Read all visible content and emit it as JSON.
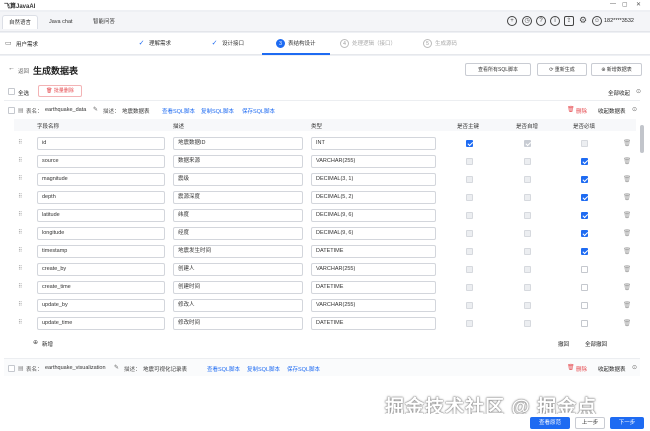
{
  "app": {
    "title": "飞算JavaAI"
  },
  "tabs": [
    {
      "label": "自然语言"
    },
    {
      "label": "Java chat"
    },
    {
      "label": "智能问答"
    }
  ],
  "user": {
    "phone": "182****3532"
  },
  "breadcrumb": {
    "label": "用户需求"
  },
  "steps": [
    {
      "label": "理解需求",
      "state": "done"
    },
    {
      "label": "设计接口",
      "state": "done"
    },
    {
      "num": "3",
      "label": "表结构设计",
      "state": "current"
    },
    {
      "num": "4",
      "label": "处理逻辑（接口）",
      "state": "todo"
    },
    {
      "num": "5",
      "label": "生成源码",
      "state": "todo"
    }
  ],
  "page": {
    "back_label": "返回",
    "title": "生成数据表"
  },
  "toolbar": {
    "view_sql": "查看所有SQL脚本",
    "regenerate": "重新生成",
    "add_table": "新增数据表",
    "select_all": "全选",
    "batch_delete": "批量删除",
    "collapse_all": "全部收起"
  },
  "table1": {
    "name_label": "表名：",
    "name": "earthquake_data",
    "desc_label": "描述：",
    "desc": "地震数据表",
    "view_sql": "查看SQL脚本",
    "copy_sql": "复制SQL脚本",
    "save_sql": "保存SQL脚本",
    "delete": "删除",
    "collapse": "收起数据表"
  },
  "columns": {
    "field": "字段名称",
    "desc": "描述",
    "type": "类型",
    "pk": "是否主键",
    "auto_inc": "是否自增",
    "required": "是否必填"
  },
  "rows": [
    {
      "field": "id",
      "desc": "地震数据ID",
      "type": "INT",
      "pk": true,
      "auto_inc": true,
      "required": false,
      "pk_disabled": false,
      "auto_disabled": true,
      "req_disabled": true
    },
    {
      "field": "source",
      "desc": "数据来源",
      "type": "VARCHAR(255)",
      "pk": false,
      "auto_inc": false,
      "required": true,
      "pk_disabled": true,
      "auto_disabled": true,
      "req_disabled": false
    },
    {
      "field": "magnitude",
      "desc": "震级",
      "type": "DECIMAL(3, 1)",
      "pk": false,
      "auto_inc": false,
      "required": true,
      "pk_disabled": true,
      "auto_disabled": true,
      "req_disabled": false
    },
    {
      "field": "depth",
      "desc": "震源深度",
      "type": "DECIMAL(5, 2)",
      "pk": false,
      "auto_inc": false,
      "required": true,
      "pk_disabled": true,
      "auto_disabled": true,
      "req_disabled": false
    },
    {
      "field": "latitude",
      "desc": "纬度",
      "type": "DECIMAL(9, 6)",
      "pk": false,
      "auto_inc": false,
      "required": true,
      "pk_disabled": true,
      "auto_disabled": true,
      "req_disabled": false
    },
    {
      "field": "longitude",
      "desc": "经度",
      "type": "DECIMAL(9, 6)",
      "pk": false,
      "auto_inc": false,
      "required": true,
      "pk_disabled": true,
      "auto_disabled": true,
      "req_disabled": false
    },
    {
      "field": "timestamp",
      "desc": "地震发生时间",
      "type": "DATETIME",
      "pk": false,
      "auto_inc": false,
      "required": true,
      "pk_disabled": true,
      "auto_disabled": true,
      "req_disabled": false
    },
    {
      "field": "create_by",
      "desc": "创建人",
      "type": "VARCHAR(255)",
      "pk": false,
      "auto_inc": false,
      "required": false,
      "pk_disabled": true,
      "auto_disabled": true,
      "req_disabled": false
    },
    {
      "field": "create_time",
      "desc": "创建时间",
      "type": "DATETIME",
      "pk": false,
      "auto_inc": false,
      "required": false,
      "pk_disabled": true,
      "auto_disabled": true,
      "req_disabled": false
    },
    {
      "field": "update_by",
      "desc": "修改人",
      "type": "VARCHAR(255)",
      "pk": false,
      "auto_inc": false,
      "required": false,
      "pk_disabled": true,
      "auto_disabled": true,
      "req_disabled": false
    },
    {
      "field": "update_time",
      "desc": "修改时间",
      "type": "DATETIME",
      "pk": false,
      "auto_inc": false,
      "required": false,
      "pk_disabled": true,
      "auto_disabled": true,
      "req_disabled": false
    }
  ],
  "table_footer": {
    "add": "新增",
    "undo": "撤回",
    "undo_all": "全部撤回"
  },
  "table2": {
    "name_label": "表名：",
    "name": "earthquake_visualization",
    "desc_label": "描述：",
    "desc": "地震可视化记录表",
    "view_sql": "查看SQL脚本",
    "copy_sql": "复制SQL脚本",
    "save_sql": "保存SQL脚本",
    "delete": "删除",
    "collapse": "收起数据表"
  },
  "footer": {
    "view_original": "查看原范",
    "prev": "上一步",
    "next": "下一步"
  },
  "watermark": {
    "text": "掘金技术社区 @ 掘金点"
  },
  "colors": {
    "accent": "#1e6bf2",
    "danger": "#e5484d"
  }
}
